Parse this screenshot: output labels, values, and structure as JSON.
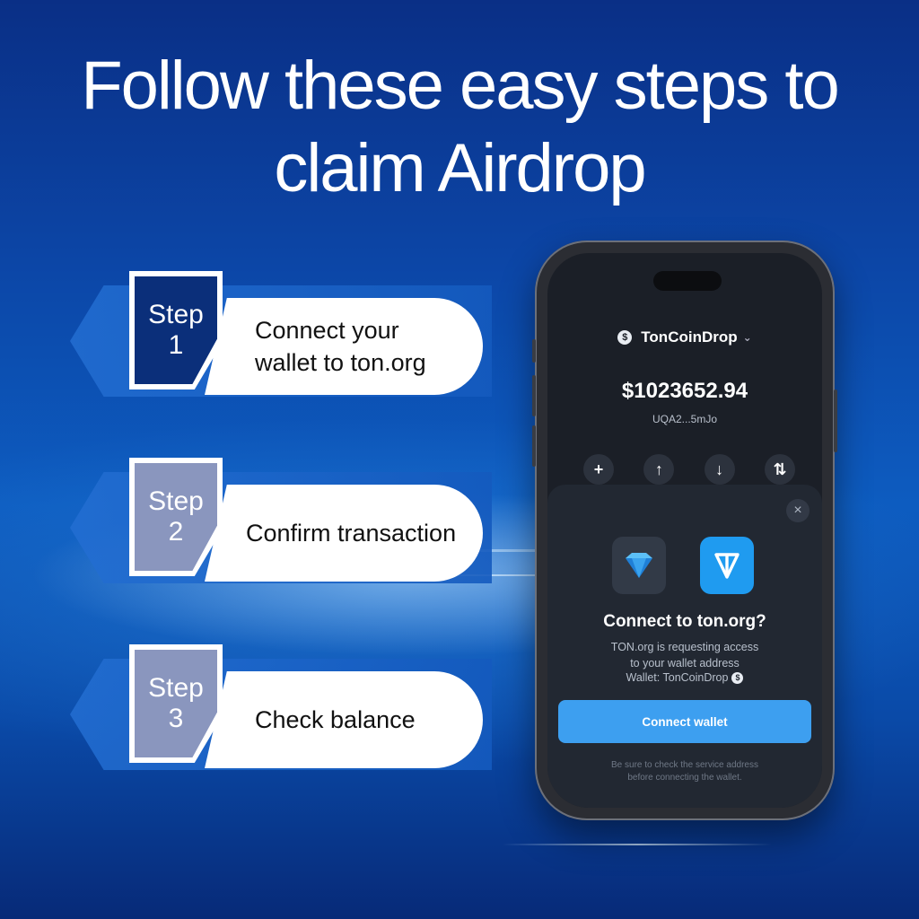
{
  "headline": {
    "line1": "Follow these easy steps to",
    "line2": "claim Airdrop"
  },
  "steps": [
    {
      "word": "Step",
      "number": "1",
      "line1": "Connect your",
      "line2": "wallet to ton.org"
    },
    {
      "word": "Step",
      "number": "2",
      "line1": "Confirm transaction",
      "line2": ""
    },
    {
      "word": "Step",
      "number": "3",
      "line1": "Check balance",
      "line2": ""
    }
  ],
  "phone": {
    "wallet_name": "TonCoinDrop",
    "coin_glyph": "$",
    "balance": "$1023652.94",
    "address": "UQA2...5mJo",
    "actions": [
      "+",
      "↑",
      "↓",
      "⇅"
    ],
    "sheet": {
      "close_glyph": "×",
      "title": "Connect to ton.org?",
      "desc_line1": "TON.org is requesting access",
      "desc_line2": "to your wallet address",
      "wallet_line": "Wallet: TonCoinDrop",
      "connect_label": "Connect wallet",
      "disclaimer_line1": "Be sure to check the service address",
      "disclaimer_line2": "before connecting the wallet."
    }
  },
  "colors": {
    "accent": "#3d9ff0",
    "tag_active": "#0b2f7a",
    "tag_inactive": "#8a96be"
  }
}
